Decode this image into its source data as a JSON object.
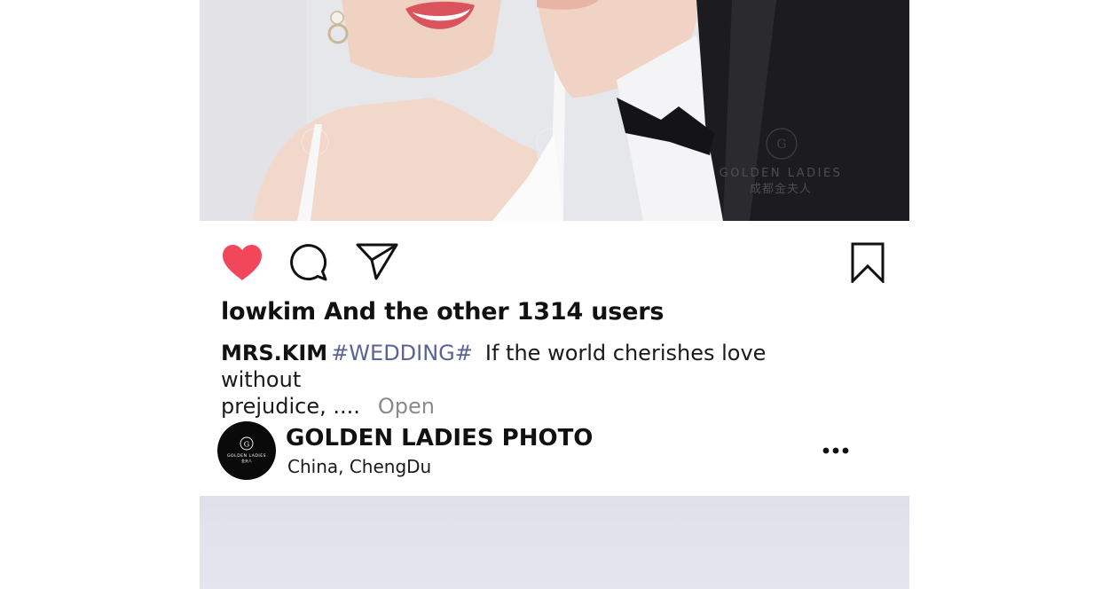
{
  "post": {
    "photo_alt": "wedding-couple-photo",
    "watermark_brand": "GOLDEN LADIES",
    "watermark_cn": "成都金夫人",
    "likes_text": "lowkim And the other 1314 users",
    "caption": {
      "username": "MRS.KIM",
      "hashtag": "#WEDDING#",
      "text_line1": "If the world cherishes love without",
      "text_line2": "prejudice, ....",
      "more_label": "Open"
    },
    "liked": true,
    "colors": {
      "heart": "#f2465a",
      "hashtag": "#5b6396",
      "muted": "#8a8a8a"
    }
  },
  "next_post": {
    "account_name": "GOLDEN LADIES PHOTO",
    "location": "China,  ChengDu",
    "avatar_brand": "GOLDEN LADIES",
    "avatar_cn": "金夫人"
  },
  "icons": {
    "like": "heart-icon",
    "comment": "comment-bubble-icon",
    "share": "send-paper-plane-icon",
    "save": "bookmark-icon",
    "more": "more-dots-icon"
  }
}
